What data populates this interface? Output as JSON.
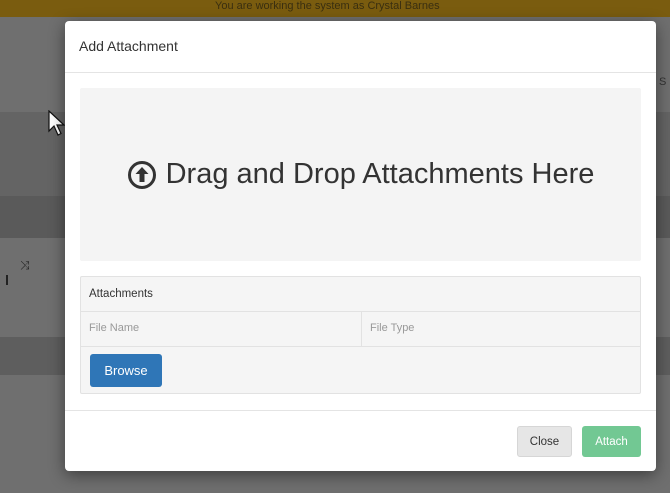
{
  "background": {
    "top_banner_text": "You are working the system as Crystal Barnes",
    "right_edge_text": "S"
  },
  "modal": {
    "title": "Add Attachment",
    "dropzone": {
      "icon": "upload-circle-icon",
      "text": "Drag and Drop Attachments Here"
    },
    "attachments": {
      "heading": "Attachments",
      "columns": [
        "File Name",
        "File Type"
      ],
      "browse_label": "Browse"
    },
    "footer": {
      "close_label": "Close",
      "attach_label": "Attach"
    }
  },
  "colors": {
    "browse_button": "#2f76b7",
    "attach_button": "#72c893",
    "close_button": "#e6e6e6",
    "banner": "#7a5c0f"
  }
}
